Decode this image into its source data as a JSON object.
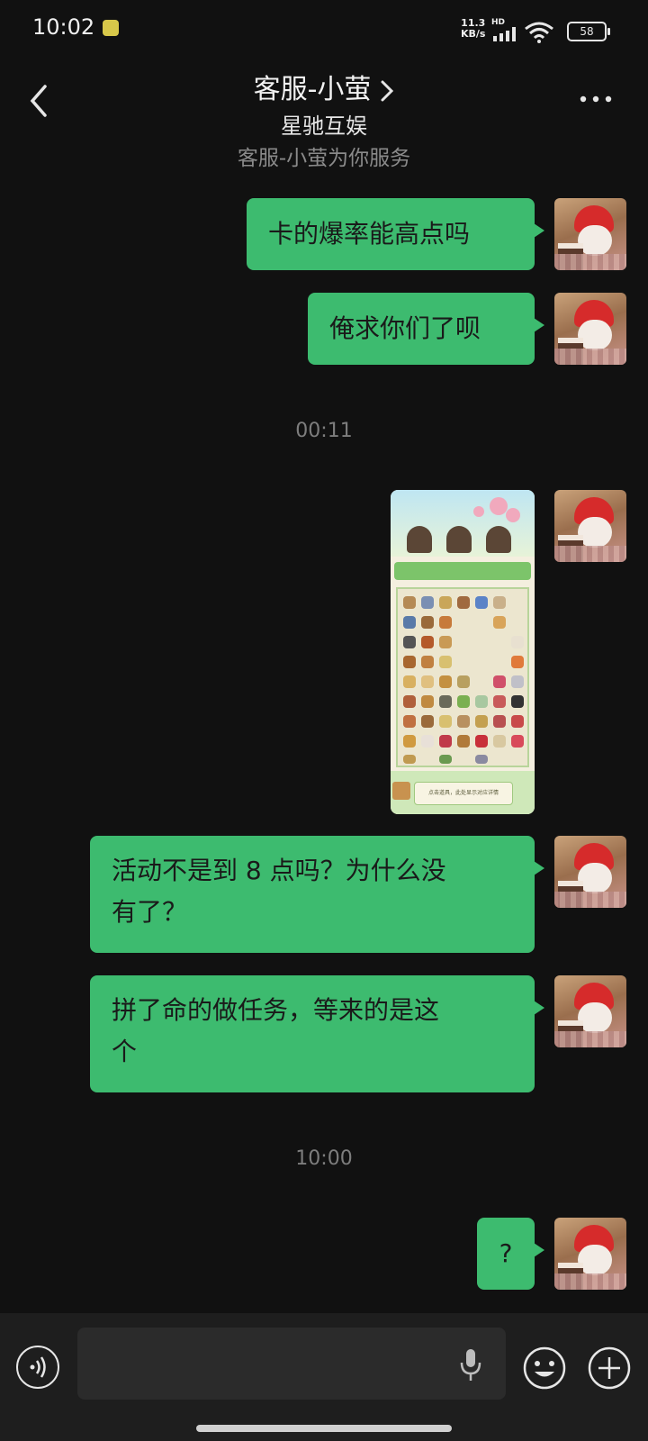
{
  "status_bar": {
    "time": "10:02",
    "speed_value": "11.3",
    "speed_unit": "KB/s",
    "hd": "HD",
    "battery": "58"
  },
  "header": {
    "title": "客服-小萤",
    "subtitle": "星驰互娱",
    "service_note": "客服-小萤为你服务"
  },
  "messages": [
    {
      "type": "text",
      "text": "卡的爆率能高点吗"
    },
    {
      "type": "text",
      "text": "俺求你们了呗"
    },
    {
      "type": "time",
      "text": "00:11"
    },
    {
      "type": "image",
      "caption": "点击道具，此处显示对应详情"
    },
    {
      "type": "text",
      "line1": "活动不是到 8 点吗？为什么没",
      "line2": "有了？"
    },
    {
      "type": "text",
      "line1": "拼了命的做任务，等来的是这",
      "line2": "个"
    },
    {
      "type": "time",
      "text": "10:00"
    },
    {
      "type": "text",
      "text": "?"
    }
  ],
  "colors": {
    "background": "#111111",
    "bubble": "#3dbb6f",
    "toolbar": "#1e1e1e"
  },
  "icons": [
    "back-arrow-icon",
    "chevron-right-icon",
    "more-icon",
    "voice-icon",
    "mic-icon",
    "emoji-icon",
    "plus-icon"
  ]
}
